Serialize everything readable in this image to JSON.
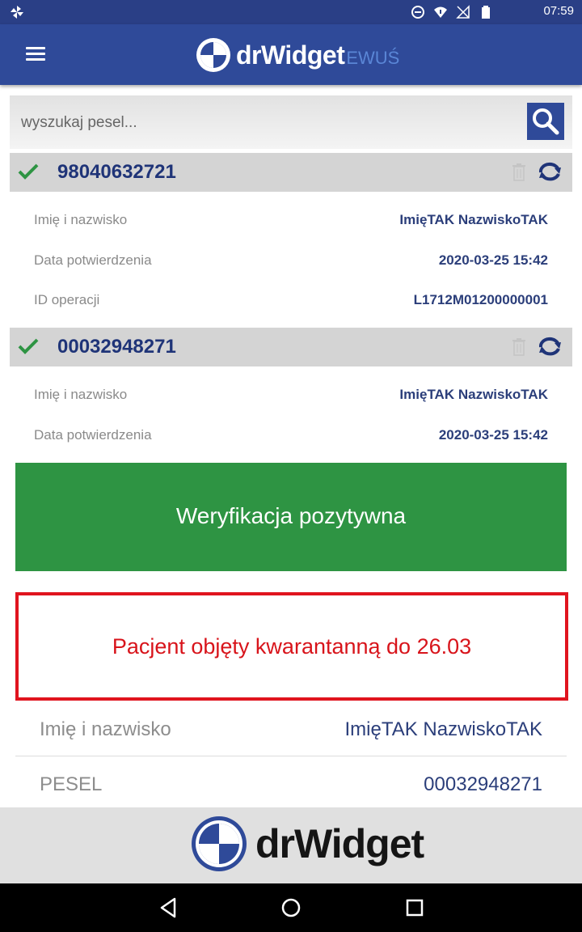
{
  "status_bar": {
    "time": "07:59"
  },
  "app_bar": {
    "logo_text": "drWidget",
    "logo_suffix": "EWUŚ"
  },
  "search": {
    "placeholder": "wyszukaj pesel..."
  },
  "entries": [
    {
      "pesel": "98040632721",
      "rows": [
        {
          "label": "Imię i nazwisko",
          "value": "ImięTAK NazwiskoTAK"
        },
        {
          "label": "Data potwierdzenia",
          "value": "2020-03-25 15:42"
        },
        {
          "label": "ID operacji",
          "value": "L1712M01200000001"
        }
      ]
    },
    {
      "pesel": "00032948271",
      "rows": [
        {
          "label": "Imię i nazwisko",
          "value": "ImięTAK  NazwiskoTAK"
        },
        {
          "label": "Data potwierdzenia",
          "value": "2020-03-25 15:42"
        }
      ]
    }
  ],
  "verification": {
    "text": "Weryfikacja pozytywna",
    "color": "#2e9443"
  },
  "alert": {
    "text": "Pacjent objęty kwarantanną do 26.03",
    "color": "#e0141e"
  },
  "details": [
    {
      "label": "Imię i nazwisko",
      "value": "ImięTAK  NazwiskoTAK"
    },
    {
      "label": "PESEL",
      "value": "00032948271"
    }
  ],
  "footer": {
    "logo_text": "drWidget"
  },
  "icons": {
    "menu": "hamburger-icon",
    "search": "search-icon",
    "check": "check-icon",
    "trash": "trash-icon",
    "refresh": "refresh-icon",
    "back": "back-icon",
    "home": "home-icon",
    "recents": "recents-icon"
  },
  "colors": {
    "brand": "#2f4a99",
    "text_value": "#2b3e7a",
    "header_bg": "#d4d4d4"
  }
}
